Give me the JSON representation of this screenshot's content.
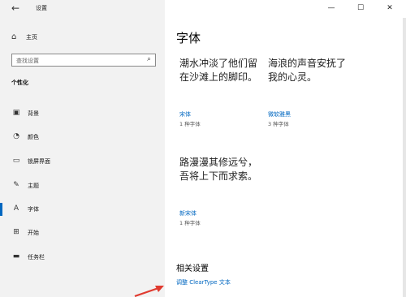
{
  "window": {
    "title": "设置",
    "back_icon": "←",
    "controls": {
      "minimize": "—",
      "maximize": "☐",
      "close": "✕"
    }
  },
  "sidebar": {
    "home_icon": "⌂",
    "home_label": "主页",
    "search_placeholder": "查找设置",
    "search_icon": "⌕",
    "section": "个性化",
    "items": [
      {
        "icon": "▣",
        "label": "背景"
      },
      {
        "icon": "◔",
        "label": "颜色"
      },
      {
        "icon": "▭",
        "label": "锁屏界面"
      },
      {
        "icon": "✎",
        "label": "主题"
      },
      {
        "icon": "A",
        "label": "字体"
      },
      {
        "icon": "⊞",
        "label": "开始"
      },
      {
        "icon": "▬",
        "label": "任务栏"
      }
    ],
    "active_index": 4
  },
  "main": {
    "title": "字体",
    "fonts": [
      {
        "preview": "潮水冲淡了他们留在沙滩上的脚印。",
        "name": "宋体",
        "count": "1 种字体"
      },
      {
        "preview": "海浪的声音安抚了我的心灵。",
        "name": "微软雅黑",
        "count": "3 种字体"
      },
      {
        "preview": "路漫漫其修远兮，吾将上下而求索。",
        "name": "新宋体",
        "count": "1 种字体"
      }
    ],
    "related_title": "相关设置",
    "related_link": "调整 ClearType 文本"
  },
  "colors": {
    "accent": "#0067c0",
    "sidebar_bg": "#f2f2f2",
    "arrow": "#e03a2f"
  }
}
